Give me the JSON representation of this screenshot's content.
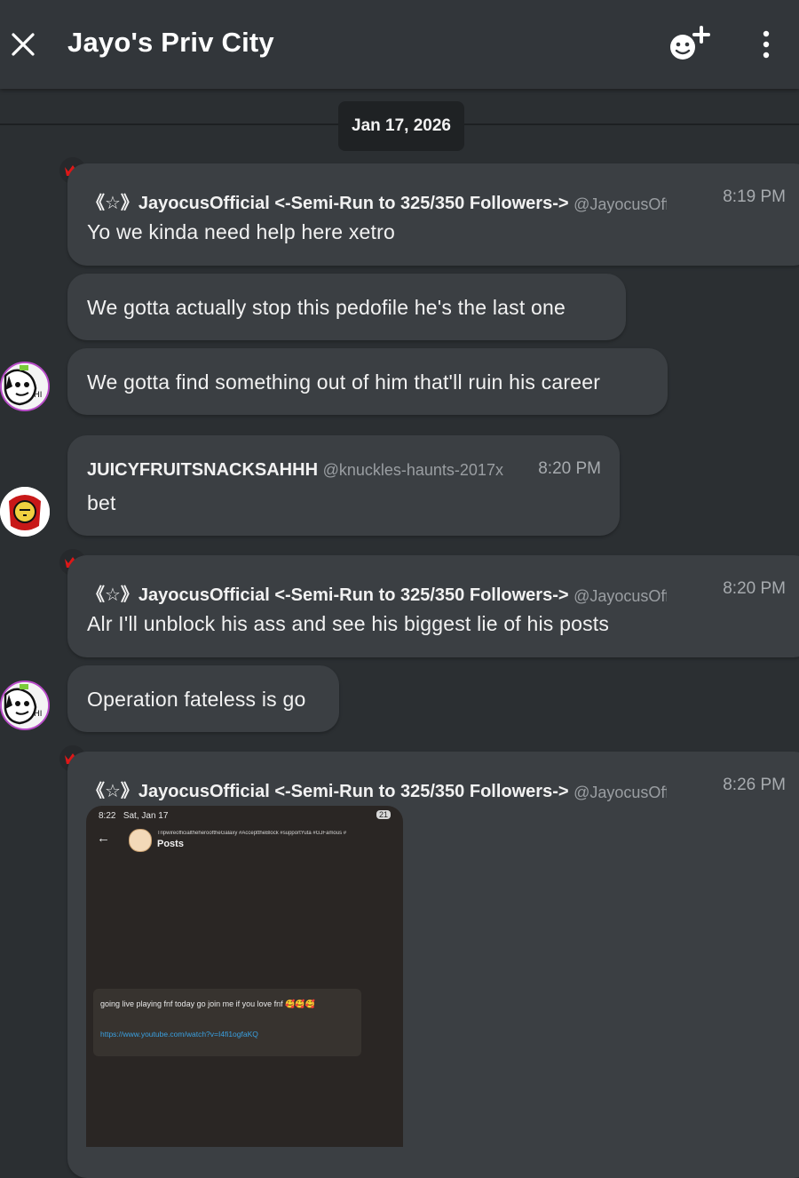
{
  "header": {
    "title": "Jayo's Priv City",
    "close_icon": "close-icon",
    "add_member_icon": "add-member-icon",
    "more_icon": "more-vertical-icon"
  },
  "date_separator": "Jan 17, 2026",
  "messages": [
    {
      "sender": "《☆》JayocusOfficial <-Semi-Run to 325/350 Followers->",
      "handle": "@JayocusOfficial",
      "time": "8:19 PM",
      "text": "Yo we kinda need help here xetro",
      "badge": "crown-icon"
    },
    {
      "text": "We gotta actually stop this pedofile he's the last one"
    },
    {
      "text": "We gotta find something out of him that'll ruin his career"
    },
    {
      "sender": "JUICYFRUITSNACKSAHHH",
      "handle": "@knuckles-haunts-2017x",
      "time": "8:20 PM",
      "text": "bet"
    },
    {
      "sender": "《☆》JayocusOfficial <-Semi-Run to 325/350 Followers->",
      "handle": "@JayocusOfficial",
      "time": "8:20 PM",
      "text": "Alr I'll unblock his ass and see his biggest lie of his posts",
      "badge": "crown-icon"
    },
    {
      "text": "Operation fateless is go"
    },
    {
      "sender": "《☆》JayocusOfficial <-Semi-Run to 325/350 Followers->",
      "handle": "@JayocusOfficial",
      "time": "8:26 PM",
      "badge": "crown-icon",
      "attachment": {
        "status_time": "8:22",
        "status_date": "Sat, Jan 17",
        "status_right": "21",
        "profile_tags": "TripwireofficialtheherooftheGalaxy #AccepttheBlock #supportYuta #GJFamous #",
        "page_title": "Posts",
        "post_text": "going live playing fnf today go join me if you love fnf 🥰🥰🥰",
        "post_link": "https://www.youtube.com/watch?v=I4fi1ogfaKQ"
      }
    }
  ],
  "colors": {
    "background": "#2b2f32",
    "bubble": "#3b3f43",
    "crown": "#e01818",
    "link": "#3aa0e0"
  }
}
